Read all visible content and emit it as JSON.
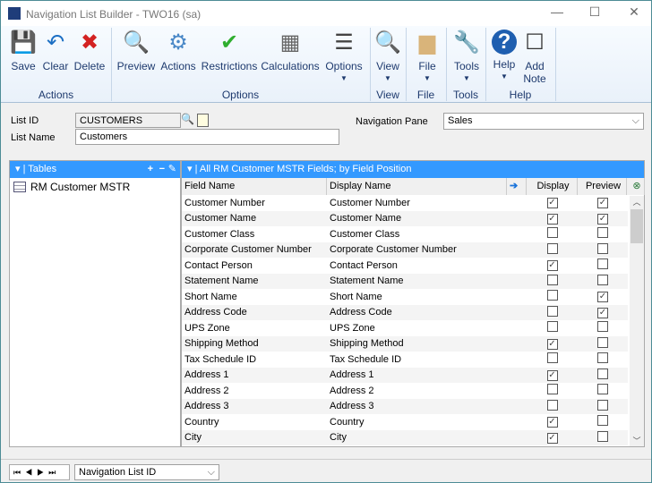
{
  "window": {
    "title": "Navigation List Builder  -  TWO16 (sa)",
    "minimize": "—",
    "maximize": "☐",
    "close": "✕"
  },
  "ribbon": {
    "buttons": [
      {
        "label": "Save",
        "icon": "save-icon"
      },
      {
        "label": "Clear",
        "icon": "undo-icon"
      },
      {
        "label": "Delete",
        "icon": "delete-x-icon"
      },
      {
        "label": "Preview",
        "icon": "preview-icon"
      },
      {
        "label": "Actions",
        "icon": "gears-icon"
      },
      {
        "label": "Restrictions",
        "icon": "checkmark-icon"
      },
      {
        "label": "Calculations",
        "icon": "calculator-icon"
      },
      {
        "label": "Options",
        "icon": "options-list-icon",
        "dropdown": true
      },
      {
        "label": "View",
        "icon": "view-icon",
        "dropdown": true
      },
      {
        "label": "File",
        "icon": "folder-icon",
        "dropdown": true
      },
      {
        "label": "Tools",
        "icon": "tools-icon",
        "dropdown": true
      },
      {
        "label": "Help",
        "icon": "help-icon",
        "dropdown": true
      },
      {
        "label": "Add\nNote",
        "icon": "add-note-icon"
      }
    ],
    "groups": [
      "Actions",
      "Options",
      "View",
      "File",
      "Tools",
      "Help"
    ]
  },
  "form": {
    "list_id_label": "List ID",
    "list_id": "CUSTOMERS",
    "list_name_label": "List Name",
    "list_name": "Customers",
    "nav_pane_label": "Navigation Pane",
    "nav_pane": "Sales"
  },
  "tables": {
    "header": "Tables",
    "add": "+",
    "remove": "−",
    "items": [
      "RM Customer MSTR"
    ]
  },
  "fields": {
    "header": "All RM Customer MSTR Fields; by Field Position",
    "columns": [
      "Field Name",
      "Display Name",
      "Display",
      "Preview"
    ],
    "rows": [
      {
        "field": "Customer Number",
        "display_name": "Customer Number",
        "display": true,
        "preview": true
      },
      {
        "field": "Customer Name",
        "display_name": "Customer Name",
        "display": true,
        "preview": true
      },
      {
        "field": "Customer Class",
        "display_name": "Customer Class",
        "display": false,
        "preview": false
      },
      {
        "field": "Corporate Customer Number",
        "display_name": "Corporate Customer Number",
        "display": false,
        "preview": false
      },
      {
        "field": "Contact Person",
        "display_name": "Contact Person",
        "display": true,
        "preview": false
      },
      {
        "field": "Statement Name",
        "display_name": "Statement Name",
        "display": false,
        "preview": false
      },
      {
        "field": "Short Name",
        "display_name": "Short Name",
        "display": false,
        "preview": true
      },
      {
        "field": "Address Code",
        "display_name": "Address Code",
        "display": false,
        "preview": true
      },
      {
        "field": "UPS Zone",
        "display_name": "UPS Zone",
        "display": false,
        "preview": false
      },
      {
        "field": "Shipping Method",
        "display_name": "Shipping Method",
        "display": true,
        "preview": false
      },
      {
        "field": "Tax Schedule ID",
        "display_name": "Tax Schedule ID",
        "display": false,
        "preview": false
      },
      {
        "field": "Address 1",
        "display_name": "Address 1",
        "display": true,
        "preview": false
      },
      {
        "field": "Address 2",
        "display_name": "Address 2",
        "display": false,
        "preview": false
      },
      {
        "field": "Address 3",
        "display_name": "Address 3",
        "display": false,
        "preview": false
      },
      {
        "field": "Country",
        "display_name": "Country",
        "display": true,
        "preview": false
      },
      {
        "field": "City",
        "display_name": "City",
        "display": true,
        "preview": false
      }
    ]
  },
  "footer": {
    "sort": "Navigation List ID"
  }
}
